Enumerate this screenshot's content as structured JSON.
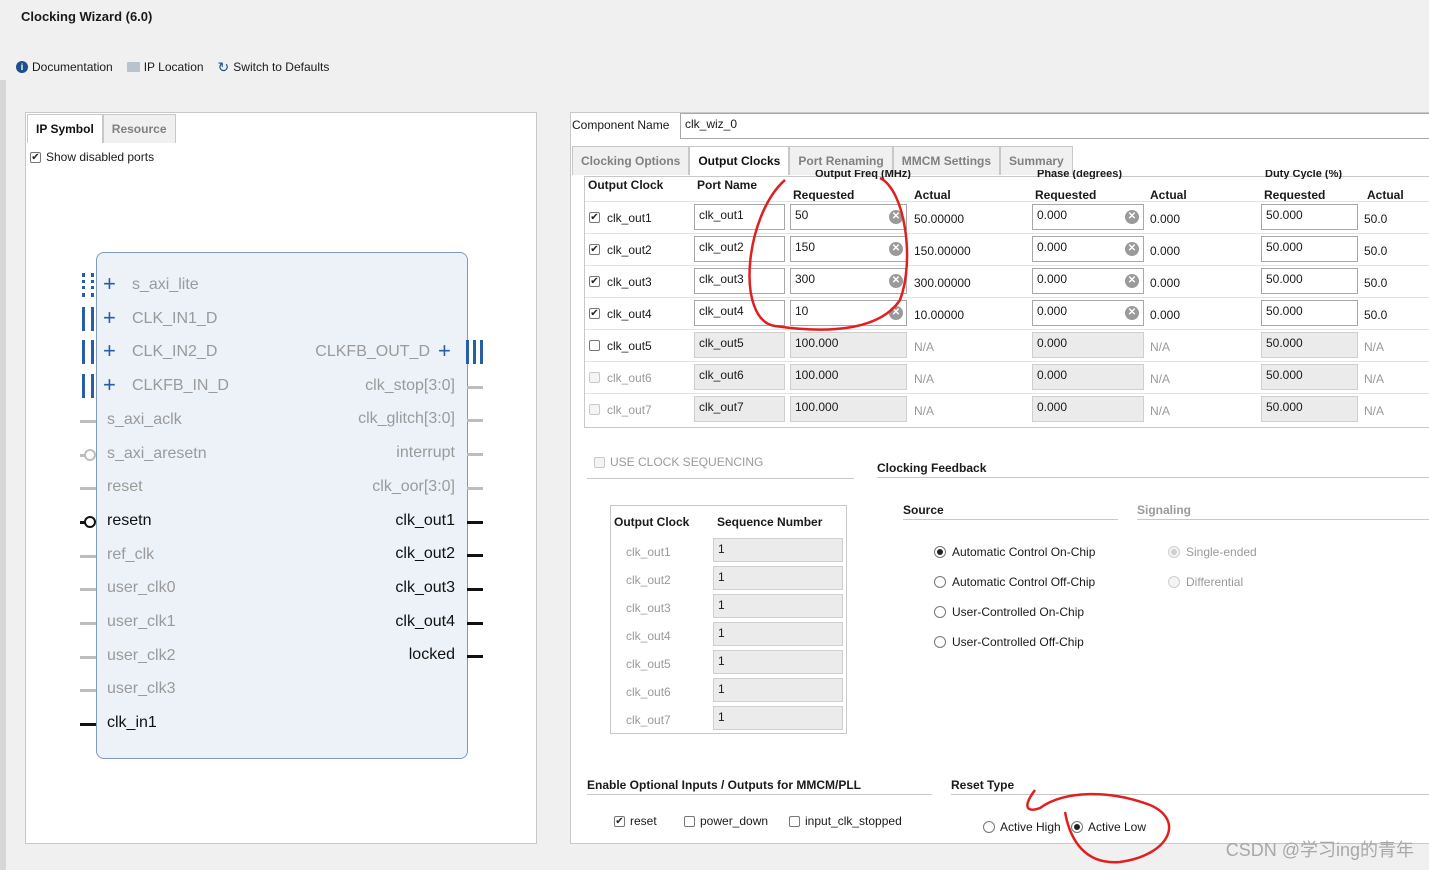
{
  "window": {
    "title": "Clocking Wizard (6.0)"
  },
  "toolbar": {
    "documentation": "Documentation",
    "ip_location": "IP Location",
    "switch_defaults": "Switch to Defaults"
  },
  "left_panel": {
    "tabs": [
      "IP Symbol",
      "Resource"
    ],
    "show_disabled": "Show disabled ports",
    "left_pins": [
      "s_axi_lite",
      "CLK_IN1_D",
      "CLK_IN2_D",
      "CLKFB_IN_D",
      "s_axi_aclk",
      "s_axi_aresetn",
      "reset",
      "resetn",
      "ref_clk",
      "user_clk0",
      "user_clk1",
      "user_clk2",
      "user_clk3",
      "clk_in1"
    ],
    "right_pins": [
      "CLKFB_OUT_D",
      "clk_stop[3:0]",
      "clk_glitch[3:0]",
      "interrupt",
      "clk_oor[3:0]",
      "clk_out1",
      "clk_out2",
      "clk_out3",
      "clk_out4",
      "locked"
    ]
  },
  "right_panel": {
    "component_label": "Component Name",
    "component_value": "clk_wiz_0",
    "tabs": [
      "Clocking Options",
      "Output Clocks",
      "Port Renaming",
      "MMCM Settings",
      "Summary"
    ],
    "grid_headers": {
      "output_clock": "Output Clock",
      "port_name": "Port Name",
      "freq_top": "Output Freq (MHz)",
      "phase_top": "Phase (degrees)",
      "duty_top": "Duty Cycle (%)",
      "requested": "Requested",
      "actual": "Actual"
    },
    "rows": [
      {
        "name": "clk_out1",
        "port": "clk_out1",
        "freq": "50",
        "freq_act": "50.00000",
        "phase": "0.000",
        "phase_act": "0.000",
        "duty": "50.000",
        "duty_act": "50.0"
      },
      {
        "name": "clk_out2",
        "port": "clk_out2",
        "freq": "150",
        "freq_act": "150.00000",
        "phase": "0.000",
        "phase_act": "0.000",
        "duty": "50.000",
        "duty_act": "50.0"
      },
      {
        "name": "clk_out3",
        "port": "clk_out3",
        "freq": "300",
        "freq_act": "300.00000",
        "phase": "0.000",
        "phase_act": "0.000",
        "duty": "50.000",
        "duty_act": "50.0"
      },
      {
        "name": "clk_out4",
        "port": "clk_out4",
        "freq": "10",
        "freq_act": "10.00000",
        "phase": "0.000",
        "phase_act": "0.000",
        "duty": "50.000",
        "duty_act": "50.0"
      },
      {
        "name": "clk_out5",
        "port": "clk_out5",
        "freq": "100.000",
        "freq_act": "N/A",
        "phase": "0.000",
        "phase_act": "N/A",
        "duty": "50.000",
        "duty_act": "N/A"
      },
      {
        "name": "clk_out6",
        "port": "clk_out6",
        "freq": "100.000",
        "freq_act": "N/A",
        "phase": "0.000",
        "phase_act": "N/A",
        "duty": "50.000",
        "duty_act": "N/A"
      },
      {
        "name": "clk_out7",
        "port": "clk_out7",
        "freq": "100.000",
        "freq_act": "N/A",
        "phase": "0.000",
        "phase_act": "N/A",
        "duty": "50.000",
        "duty_act": "N/A"
      }
    ],
    "use_clock_seq": "USE CLOCK SEQUENCING",
    "seq_headers": {
      "output_clock": "Output Clock",
      "seq_num": "Sequence Number"
    },
    "seq_rows": [
      {
        "name": "clk_out1",
        "num": "1"
      },
      {
        "name": "clk_out2",
        "num": "1"
      },
      {
        "name": "clk_out3",
        "num": "1"
      },
      {
        "name": "clk_out4",
        "num": "1"
      },
      {
        "name": "clk_out5",
        "num": "1"
      },
      {
        "name": "clk_out6",
        "num": "1"
      },
      {
        "name": "clk_out7",
        "num": "1"
      }
    ],
    "feedback": {
      "title": "Clocking Feedback",
      "source": "Source",
      "signaling": "Signaling",
      "sources": [
        "Automatic Control On-Chip",
        "Automatic Control Off-Chip",
        "User-Controlled On-Chip",
        "User-Controlled Off-Chip"
      ],
      "signals": [
        "Single-ended",
        "Differential"
      ]
    },
    "optional": {
      "title": "Enable Optional Inputs / Outputs for MMCM/PLL",
      "reset": "reset",
      "power_down": "power_down",
      "input_clk_stopped": "input_clk_stopped"
    },
    "reset_type": {
      "title": "Reset Type",
      "high": "Active High",
      "low": "Active Low"
    }
  },
  "watermark": "CSDN @学习ing的青年"
}
